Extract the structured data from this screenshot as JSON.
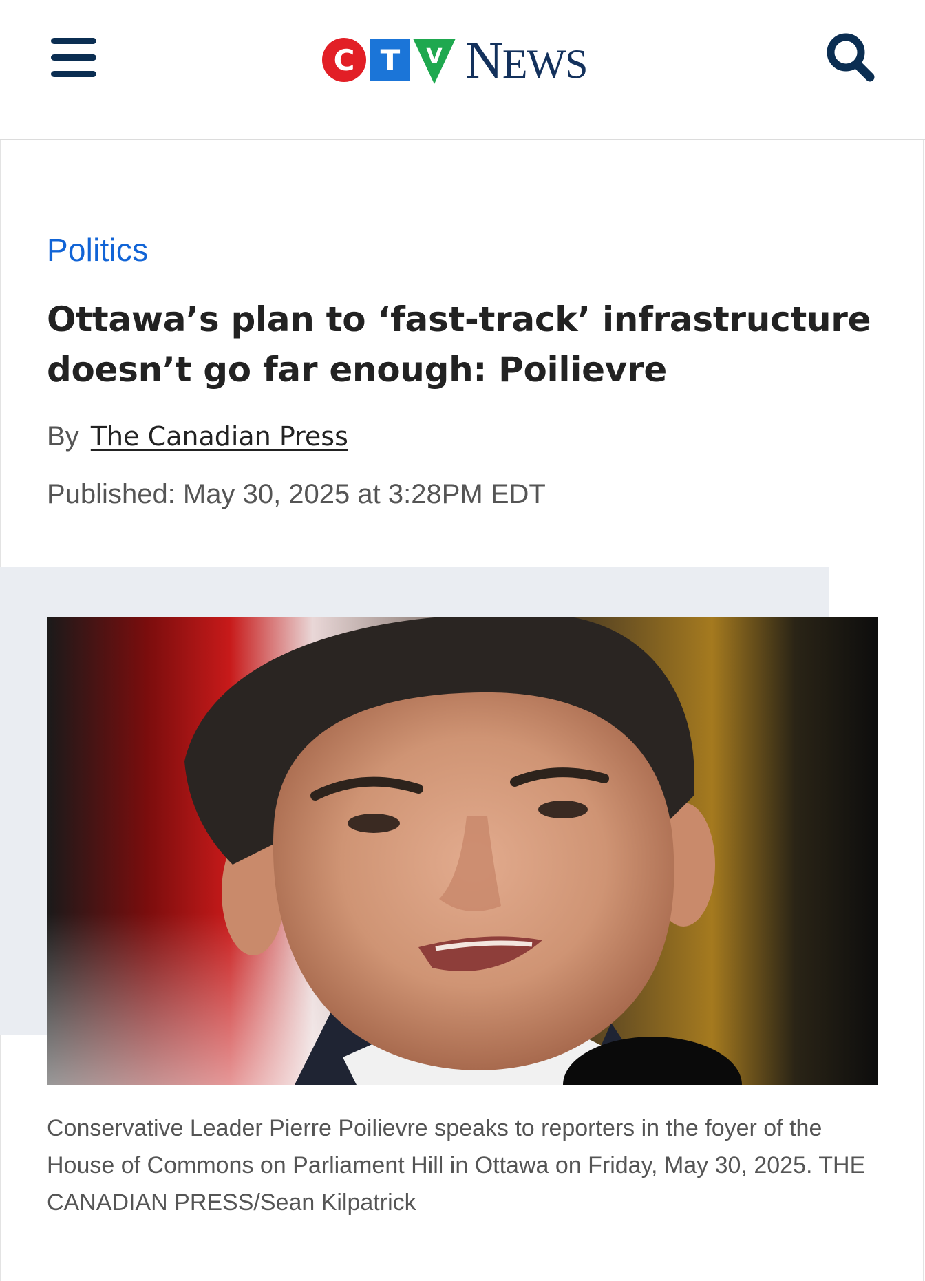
{
  "header": {
    "logo": {
      "c": "C",
      "t": "T",
      "v": "V",
      "wordmark_first": "N",
      "wordmark_rest": "EWS"
    },
    "colors": {
      "c_red": "#e21f26",
      "t_blue": "#1b75d8",
      "v_green": "#1fa84f",
      "navy": "#13315c"
    },
    "menu_icon": "hamburger-menu-icon",
    "search_icon": "search-icon"
  },
  "article": {
    "section": "Politics",
    "headline": "Ottawa’s plan to ‘fast-track’ infrastructure doesn’t go far enough: Poilievre",
    "byline_prefix": "By",
    "author": "The Canadian Press",
    "published": "Published: May 30, 2025 at 3:28PM EDT",
    "caption": "Conservative Leader Pierre Poilievre speaks to reporters in the foyer of the House of Commons on Parliament Hill in Ottawa on Friday, May 30, 2025. THE CANADIAN PRESS/Sean Kilpatrick"
  }
}
